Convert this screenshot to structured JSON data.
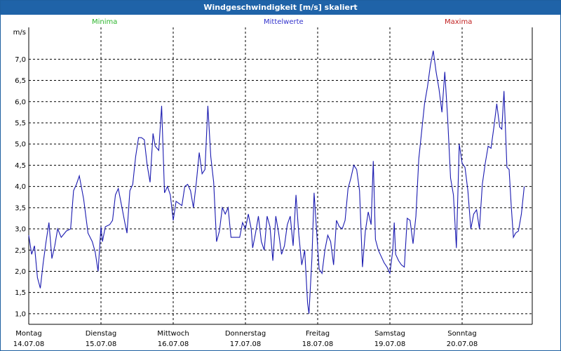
{
  "title": "Windgeschwindigkeit [m/s] skaliert",
  "legend": [
    {
      "label": "Minima",
      "color": "#2db52d"
    },
    {
      "label": "Mittelwerte",
      "color": "#3333cc"
    },
    {
      "label": "Maxima",
      "color": "#c02020"
    }
  ],
  "colors": {
    "titlebar": "#1f63a8",
    "series": "#1a1ab0",
    "grid": "#000000"
  },
  "chart_data": {
    "type": "line",
    "ylabel": "m/s",
    "ylim": [
      0.75,
      7.75
    ],
    "yticks": [
      "1,0",
      "1,5",
      "2,0",
      "2,5",
      "3,0",
      "3,5",
      "4,0",
      "4,5",
      "5,0",
      "5,5",
      "6,0",
      "6,5",
      "7,0"
    ],
    "yvalues": [
      1.0,
      1.5,
      2.0,
      2.5,
      3.0,
      3.5,
      4.0,
      4.5,
      5.0,
      5.5,
      6.0,
      6.5,
      7.0
    ],
    "xlim": [
      0,
      7
    ],
    "days": [
      {
        "day": "Montag",
        "date": "14.07.08"
      },
      {
        "day": "Dienstag",
        "date": "15.07.08"
      },
      {
        "day": "Mittwoch",
        "date": "16.07.08"
      },
      {
        "day": "Donnerstag",
        "date": "17.07.08"
      },
      {
        "day": "Freitag",
        "date": "18.07.08"
      },
      {
        "day": "Samstag",
        "date": "19.07.08"
      },
      {
        "day": "Sonntag",
        "date": "20.07.08"
      }
    ],
    "grid": true,
    "series": [
      {
        "name": "Mittelwerte",
        "values": [
          [
            0.0,
            2.85
          ],
          [
            0.04,
            2.4
          ],
          [
            0.08,
            2.6
          ],
          [
            0.12,
            1.85
          ],
          [
            0.16,
            1.6
          ],
          [
            0.2,
            2.2
          ],
          [
            0.24,
            2.7
          ],
          [
            0.28,
            3.15
          ],
          [
            0.32,
            2.3
          ],
          [
            0.36,
            2.6
          ],
          [
            0.4,
            3.0
          ],
          [
            0.45,
            2.8
          ],
          [
            0.52,
            2.95
          ],
          [
            0.58,
            3.0
          ],
          [
            0.62,
            3.9
          ],
          [
            0.66,
            4.05
          ],
          [
            0.7,
            4.25
          ],
          [
            0.76,
            3.7
          ],
          [
            0.82,
            2.9
          ],
          [
            0.88,
            2.7
          ],
          [
            0.92,
            2.45
          ],
          [
            0.96,
            2.0
          ],
          [
            1.0,
            3.05
          ],
          [
            1.02,
            2.7
          ],
          [
            1.06,
            3.05
          ],
          [
            1.12,
            3.1
          ],
          [
            1.16,
            3.2
          ],
          [
            1.2,
            3.8
          ],
          [
            1.24,
            3.95
          ],
          [
            1.28,
            3.6
          ],
          [
            1.33,
            3.15
          ],
          [
            1.36,
            2.9
          ],
          [
            1.4,
            3.9
          ],
          [
            1.44,
            4.05
          ],
          [
            1.48,
            4.7
          ],
          [
            1.52,
            5.15
          ],
          [
            1.56,
            5.15
          ],
          [
            1.6,
            5.1
          ],
          [
            1.64,
            4.5
          ],
          [
            1.68,
            4.1
          ],
          [
            1.72,
            5.25
          ],
          [
            1.75,
            4.95
          ],
          [
            1.8,
            4.85
          ],
          [
            1.84,
            5.9
          ],
          [
            1.88,
            3.85
          ],
          [
            1.92,
            4.0
          ],
          [
            1.96,
            3.8
          ],
          [
            2.0,
            3.2
          ],
          [
            2.04,
            3.65
          ],
          [
            2.08,
            3.6
          ],
          [
            2.12,
            3.55
          ],
          [
            2.16,
            4.0
          ],
          [
            2.2,
            4.05
          ],
          [
            2.24,
            3.9
          ],
          [
            2.28,
            3.5
          ],
          [
            2.32,
            4.1
          ],
          [
            2.36,
            4.8
          ],
          [
            2.4,
            4.3
          ],
          [
            2.44,
            4.4
          ],
          [
            2.48,
            5.9
          ],
          [
            2.52,
            4.7
          ],
          [
            2.56,
            4.1
          ],
          [
            2.6,
            2.7
          ],
          [
            2.64,
            2.95
          ],
          [
            2.68,
            3.5
          ],
          [
            2.72,
            3.35
          ],
          [
            2.76,
            3.5
          ],
          [
            2.8,
            2.8
          ],
          [
            2.84,
            2.8
          ],
          [
            2.88,
            2.8
          ],
          [
            2.92,
            2.8
          ],
          [
            2.96,
            3.15
          ],
          [
            3.0,
            3.0
          ],
          [
            3.04,
            3.35
          ],
          [
            3.08,
            3.0
          ],
          [
            3.1,
            2.55
          ],
          [
            3.14,
            2.9
          ],
          [
            3.18,
            3.3
          ],
          [
            3.22,
            2.7
          ],
          [
            3.26,
            2.5
          ],
          [
            3.3,
            3.3
          ],
          [
            3.34,
            3.05
          ],
          [
            3.38,
            2.25
          ],
          [
            3.42,
            3.3
          ],
          [
            3.46,
            2.9
          ],
          [
            3.5,
            2.4
          ],
          [
            3.54,
            2.6
          ],
          [
            3.58,
            3.1
          ],
          [
            3.62,
            3.3
          ],
          [
            3.66,
            2.6
          ],
          [
            3.7,
            3.8
          ],
          [
            3.74,
            2.85
          ],
          [
            3.78,
            2.15
          ],
          [
            3.82,
            2.5
          ],
          [
            3.86,
            1.25
          ],
          [
            3.88,
            1.0
          ],
          [
            3.92,
            2.3
          ],
          [
            3.95,
            3.85
          ],
          [
            3.98,
            3.1
          ],
          [
            4.02,
            2.05
          ],
          [
            4.06,
            1.95
          ],
          [
            4.1,
            2.5
          ],
          [
            4.14,
            2.85
          ],
          [
            4.18,
            2.7
          ],
          [
            4.22,
            2.15
          ],
          [
            4.26,
            3.2
          ],
          [
            4.3,
            3.05
          ],
          [
            4.34,
            3.0
          ],
          [
            4.38,
            3.2
          ],
          [
            4.42,
            3.95
          ],
          [
            4.46,
            4.2
          ],
          [
            4.5,
            4.5
          ],
          [
            4.54,
            4.4
          ],
          [
            4.58,
            3.9
          ],
          [
            4.62,
            2.1
          ],
          [
            4.66,
            2.95
          ],
          [
            4.7,
            3.4
          ],
          [
            4.74,
            3.1
          ],
          [
            4.77,
            4.6
          ],
          [
            4.8,
            2.75
          ],
          [
            4.84,
            2.5
          ],
          [
            4.88,
            2.35
          ],
          [
            4.92,
            2.2
          ],
          [
            4.96,
            2.1
          ],
          [
            5.0,
            1.95
          ],
          [
            5.04,
            2.5
          ],
          [
            5.06,
            3.15
          ],
          [
            5.08,
            2.4
          ],
          [
            5.12,
            2.25
          ],
          [
            5.16,
            2.15
          ],
          [
            5.2,
            2.1
          ],
          [
            5.24,
            3.25
          ],
          [
            5.28,
            3.2
          ],
          [
            5.32,
            2.65
          ],
          [
            5.36,
            3.3
          ],
          [
            5.4,
            4.65
          ],
          [
            5.44,
            5.3
          ],
          [
            5.48,
            5.95
          ],
          [
            5.52,
            6.35
          ],
          [
            5.56,
            6.85
          ],
          [
            5.6,
            7.2
          ],
          [
            5.64,
            6.7
          ],
          [
            5.68,
            6.3
          ],
          [
            5.72,
            5.75
          ],
          [
            5.76,
            6.7
          ],
          [
            5.8,
            5.6
          ],
          [
            5.84,
            4.2
          ],
          [
            5.88,
            3.8
          ],
          [
            5.92,
            2.55
          ],
          [
            5.96,
            5.0
          ],
          [
            6.0,
            4.55
          ],
          [
            6.04,
            4.45
          ],
          [
            6.08,
            3.9
          ],
          [
            6.12,
            3.0
          ],
          [
            6.16,
            3.35
          ],
          [
            6.2,
            3.45
          ],
          [
            6.24,
            3.0
          ],
          [
            6.28,
            4.05
          ],
          [
            6.32,
            4.55
          ],
          [
            6.36,
            4.95
          ],
          [
            6.4,
            4.9
          ],
          [
            6.44,
            5.4
          ],
          [
            6.48,
            5.95
          ],
          [
            6.52,
            5.4
          ],
          [
            6.55,
            5.35
          ],
          [
            6.58,
            6.25
          ],
          [
            6.62,
            4.45
          ],
          [
            6.65,
            4.4
          ],
          [
            6.68,
            3.55
          ],
          [
            6.71,
            2.8
          ],
          [
            6.74,
            2.9
          ],
          [
            6.78,
            2.95
          ],
          [
            6.82,
            3.35
          ],
          [
            6.86,
            4.0
          ]
        ]
      }
    ]
  }
}
